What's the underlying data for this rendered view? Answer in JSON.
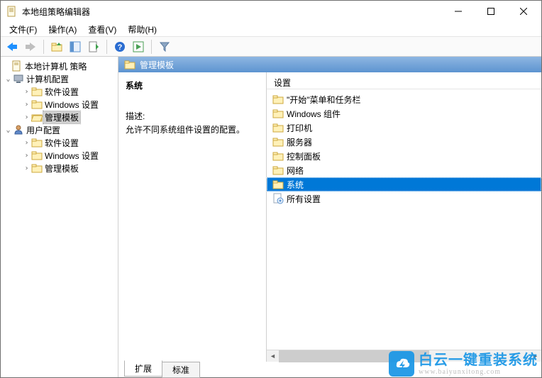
{
  "window": {
    "title": "本地组策略编辑器"
  },
  "menu": {
    "file": "文件(F)",
    "action": "操作(A)",
    "view": "查看(V)",
    "help": "帮助(H)"
  },
  "tree": {
    "root": "本地计算机 策略",
    "computer_config": "计算机配置",
    "software_settings_1": "软件设置",
    "windows_settings_1": "Windows 设置",
    "admin_templates_1": "管理模板",
    "user_config": "用户配置",
    "software_settings_2": "软件设置",
    "windows_settings_2": "Windows 设置",
    "admin_templates_2": "管理模板"
  },
  "content": {
    "header": "管理模板",
    "selected_title": "系统",
    "desc_label": "描述:",
    "desc_text": "允许不同系统组件设置的配置。",
    "list_header": "设置",
    "items": [
      "\"开始\"菜单和任务栏",
      "Windows 组件",
      "打印机",
      "服务器",
      "控制面板",
      "网络",
      "系统",
      "所有设置"
    ],
    "selected_index": 6
  },
  "bottom_tabs": {
    "extended": "扩展",
    "standard": "标准"
  },
  "watermark": {
    "main": "白云一键重装系统",
    "sub": "www.baiyunxitong.com"
  }
}
